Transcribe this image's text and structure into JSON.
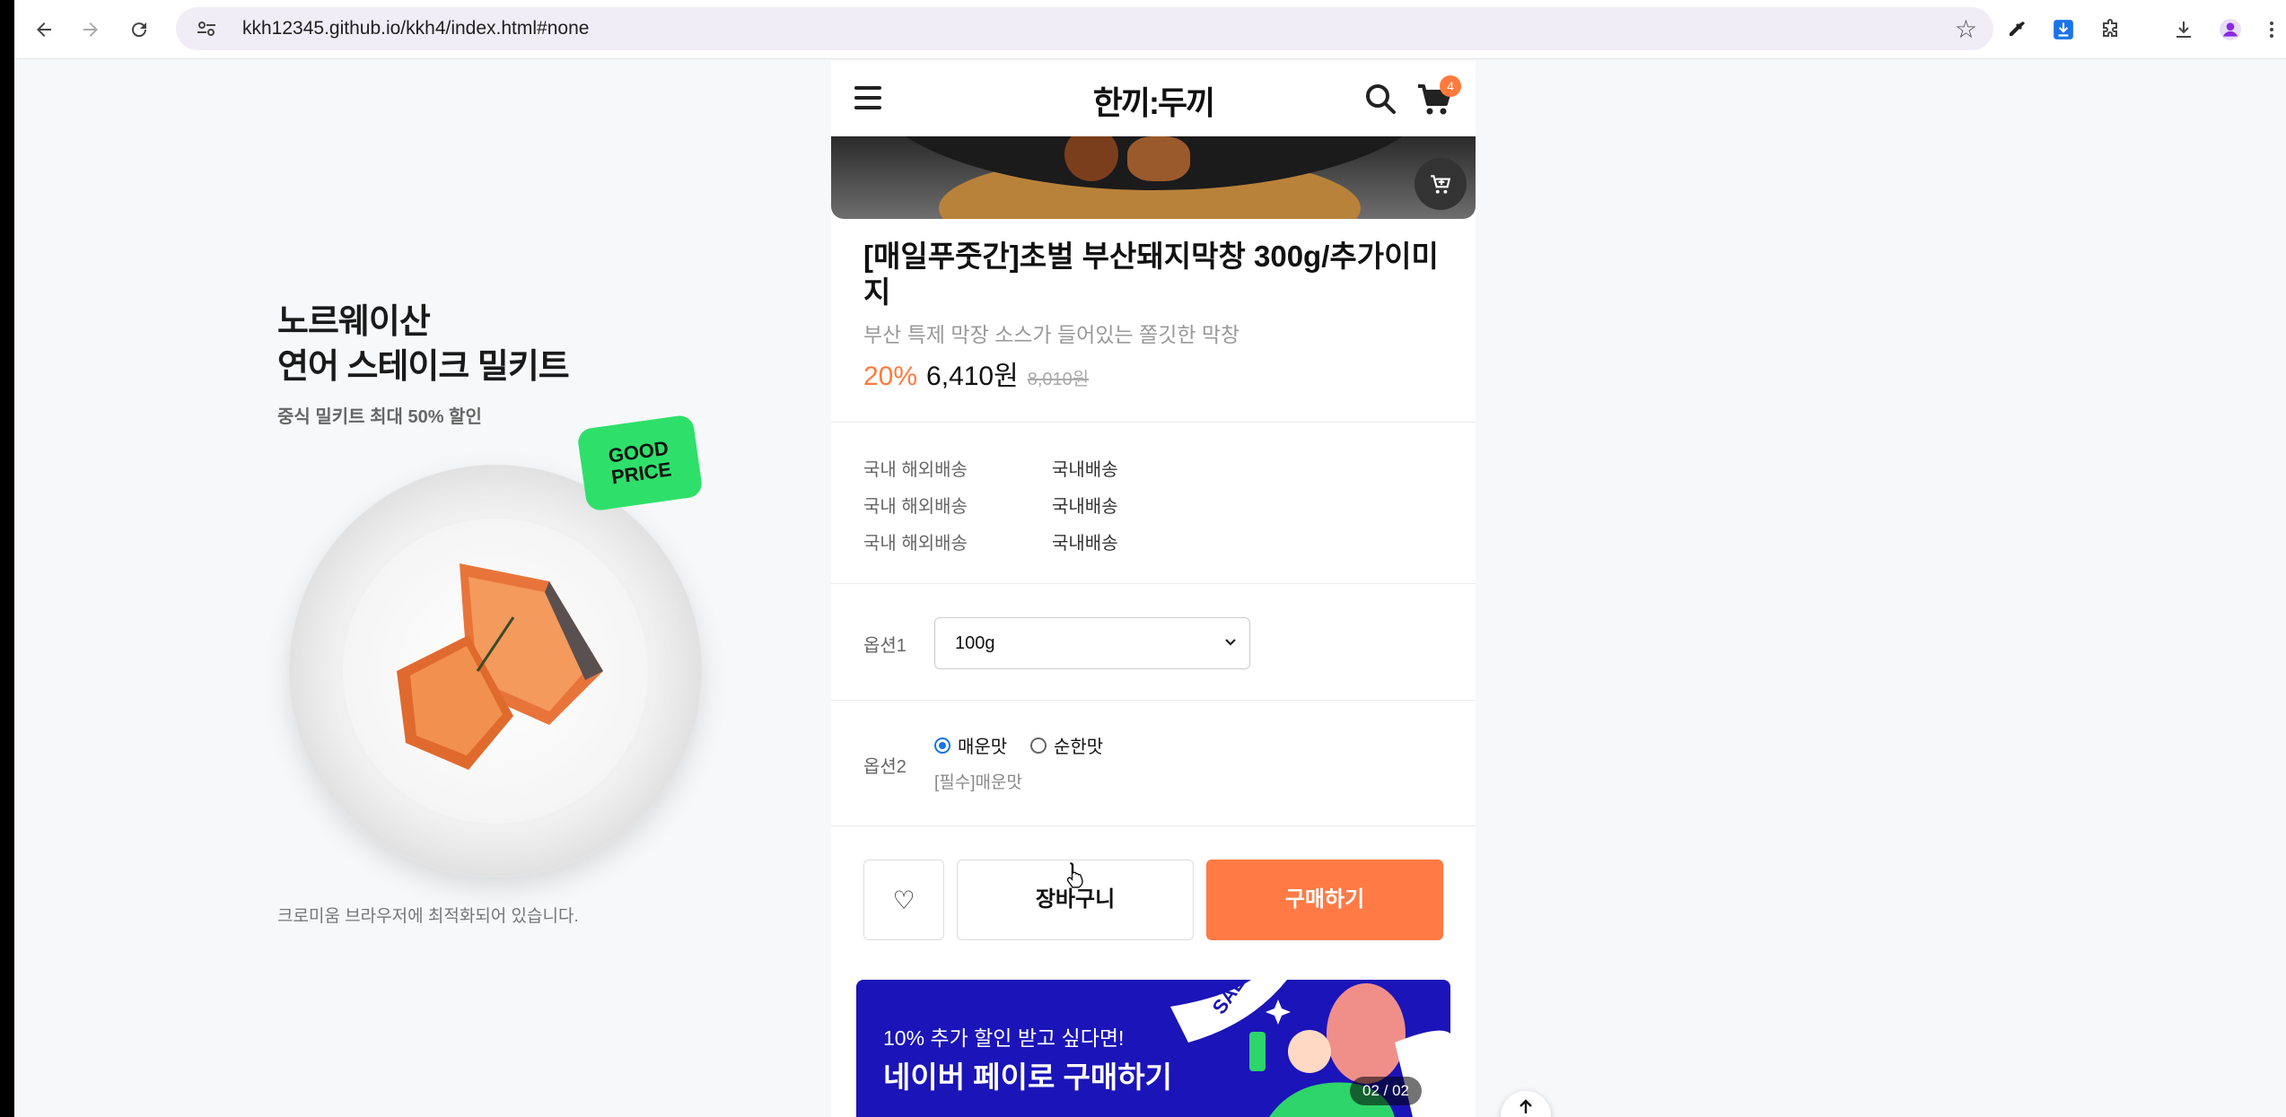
{
  "browser": {
    "url": "kkh12345.github.io/kkh4/index.html#none",
    "icons": [
      "back-icon",
      "forward-icon",
      "reload-icon",
      "site-info-icon",
      "bookmark-star-icon",
      "eyedropper-icon",
      "download-ext-icon",
      "extensions-icon",
      "downloads-icon",
      "profile-icon",
      "more-icon"
    ]
  },
  "promo": {
    "title_line1": "노르웨이산",
    "title_line2": "연어 스테이크 밀키트",
    "subtitle": "중식 밀키트 최대 50% 할인",
    "badge_line1": "GOOD",
    "badge_line2": "PRICE",
    "note": "크로미움 브라우저에 최적화되어 있습니다."
  },
  "header": {
    "logo": "한끼:두끼",
    "cart_count": "4"
  },
  "product": {
    "title": "[매일푸줏간]초벌 부산돼지막창 300g/추가이미지",
    "description": "부산 특제 막장 소스가 들어있는 쫄깃한 막창",
    "discount": "20%",
    "sale_price": "6,410원",
    "original_price": "8,010원"
  },
  "shipping": [
    {
      "label": "국내 해외배송",
      "value": "국내배송"
    },
    {
      "label": "국내 해외배송",
      "value": "국내배송"
    },
    {
      "label": "국내 해외배송",
      "value": "국내배송"
    }
  ],
  "options": {
    "option1_label": "옵션1",
    "option1_selected": "100g",
    "option2_label": "옵션2",
    "radio1": "매운맛",
    "radio2": "순한맛",
    "required_note": "[필수]매운맛"
  },
  "actions": {
    "wish_symbol": "♡",
    "cart_label": "장바구니",
    "buy_label": "구매하기"
  },
  "banner": {
    "subtitle": "10% 추가 할인 받고 싶다면!",
    "title": "네이버 페이로 구매하기",
    "counter": "02 / 02",
    "sticker": "SALE"
  },
  "colors": {
    "accent": "#ff7a45",
    "banner_bg": "#1b14b8",
    "badge_green": "#2ee06a"
  }
}
